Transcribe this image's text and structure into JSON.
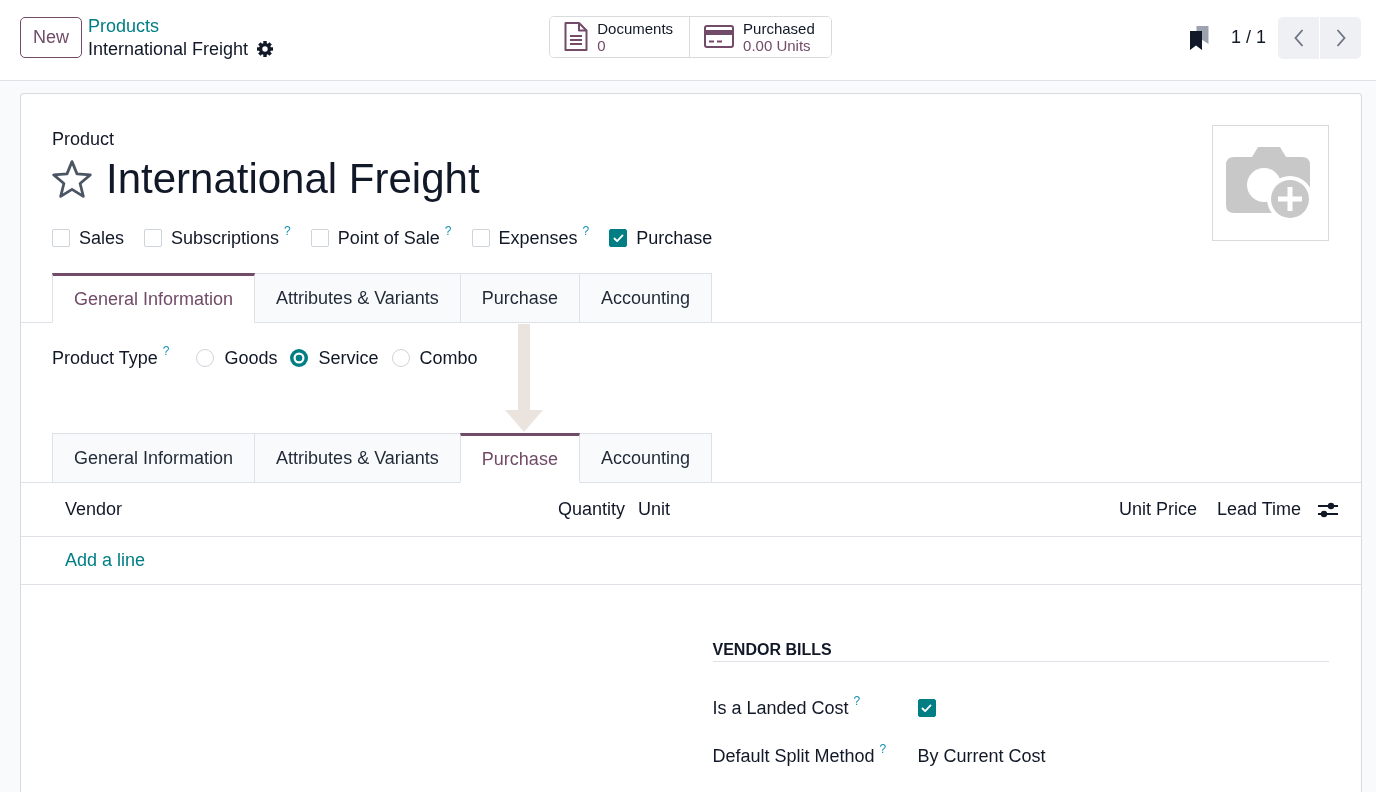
{
  "control_panel": {
    "new_button": "New",
    "breadcrumb": {
      "parent": "Products",
      "current": "International Freight"
    },
    "stat_buttons": [
      {
        "kind": "document",
        "label": "Documents",
        "value": "0"
      },
      {
        "kind": "card",
        "label": "Purchased",
        "value": "0.00 Units"
      }
    ],
    "pager": {
      "value": "1 / 1"
    }
  },
  "product_form": {
    "record_label": "Product",
    "favorite": false,
    "title": "International Freight",
    "options": [
      {
        "label": "Sales",
        "checked": false
      },
      {
        "label": "Subscriptions",
        "help": "?",
        "checked": false
      },
      {
        "label": "Point of Sale",
        "help": "?",
        "checked": false
      },
      {
        "label": "Expenses",
        "help": "?",
        "checked": false
      },
      {
        "label": "Purchase",
        "checked": true
      }
    ],
    "notebook_before": {
      "tabs": [
        {
          "label": "General Information",
          "selected": true
        },
        {
          "label": "Attributes & Variants",
          "selected": false
        },
        {
          "label": "Purchase",
          "selected": false
        },
        {
          "label": "Accounting",
          "selected": false
        }
      ]
    },
    "general_tab": {
      "product_type": {
        "label": "Product Type",
        "help": "?",
        "choices": [
          {
            "label": "Goods",
            "selected": false
          },
          {
            "label": "Service",
            "selected": true
          },
          {
            "label": "Combo",
            "selected": false
          }
        ]
      }
    },
    "notebook_after": {
      "tabs": [
        {
          "label": "General Information",
          "selected": false
        },
        {
          "label": "Attributes & Variants",
          "selected": false
        },
        {
          "label": "Purchase",
          "selected": true
        },
        {
          "label": "Accounting",
          "selected": false
        }
      ]
    },
    "purchase_tab": {
      "vendor_table": {
        "columns": [
          "Vendor",
          "Quantity",
          "Unit",
          "Unit Price",
          "Lead Time"
        ],
        "add_line": "Add a line"
      },
      "vendor_bills": {
        "title": "VENDOR BILLS",
        "fields": [
          {
            "kind": "checkbox",
            "label": "Is a Landed Cost",
            "help": "?",
            "checked": true
          },
          {
            "kind": "text",
            "label": "Default Split Method",
            "help": "?",
            "value": "By Current Cost"
          }
        ]
      }
    }
  }
}
